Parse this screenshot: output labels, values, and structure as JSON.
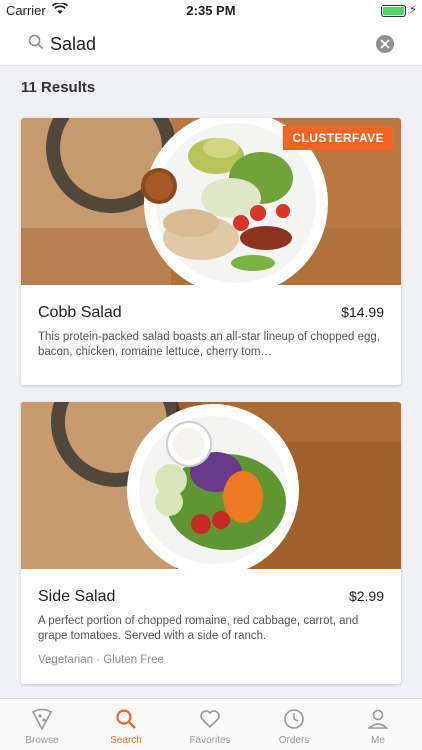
{
  "status": {
    "carrier": "Carrier",
    "time": "2:35 PM"
  },
  "search": {
    "query": "Salad",
    "placeholder": "Search"
  },
  "results": {
    "title": "11 Results",
    "items": [
      {
        "badge": "CLUSTERFAVE",
        "name": "Cobb Salad",
        "price": "$14.99",
        "description": "This protein-packed salad boasts an all-star lineup of chopped egg, bacon, chicken, romaine lettuce, cherry tom…"
      },
      {
        "name": "Side Salad",
        "price": "$2.99",
        "description": "A perfect portion of chopped romaine, red cabbage, carrot, and grape tomatoes. Served with a side of ranch.",
        "tags": "Vegetarian · Gluten Free"
      }
    ]
  },
  "tabs": [
    {
      "label": "Browse",
      "icon": "browse-icon"
    },
    {
      "label": "Search",
      "icon": "search-icon",
      "active": true
    },
    {
      "label": "Favorites",
      "icon": "heart-icon"
    },
    {
      "label": "Orders",
      "icon": "clock-icon"
    },
    {
      "label": "Me",
      "icon": "person-icon"
    }
  ],
  "colors": {
    "accent": "#f26522",
    "background": "#f0f1f5"
  }
}
